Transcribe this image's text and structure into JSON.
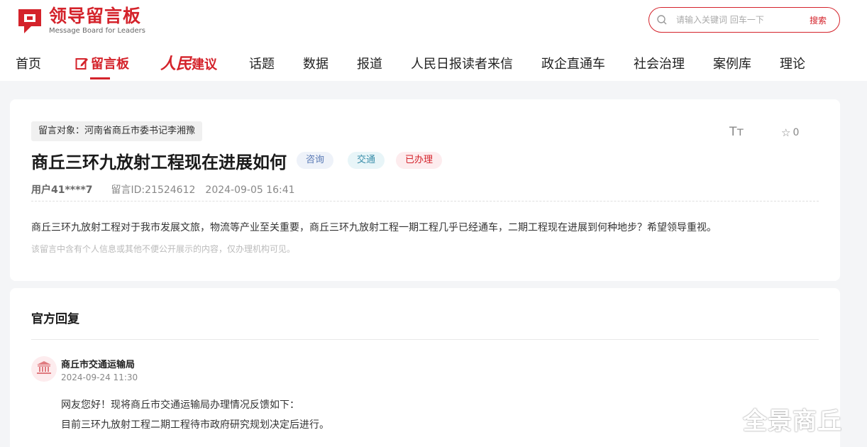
{
  "header": {
    "logo_cn": "领导留言板",
    "logo_en": "Message Board for Leaders",
    "search_placeholder": "请输入关键词 回车一下",
    "search_button": "搜索"
  },
  "nav": {
    "home": "首页",
    "board": "留言板",
    "renmin": "人民",
    "renmin_tail": "建议",
    "topics": "话题",
    "data": "数据",
    "reports": "报道",
    "reader_letters": "人民日报读者来信",
    "gov_enterprise": "政企直通车",
    "governance": "社会治理",
    "cases": "案例库",
    "theory": "理论"
  },
  "message": {
    "target": "留言对象：河南省商丘市委书记李湘豫",
    "font_btn": "Tт",
    "fav_star": "☆",
    "fav_count": "0",
    "title": "商丘三环九放射工程现在进展如何",
    "badges": [
      "咨询",
      "交通",
      "已办理"
    ],
    "user": "用户41****7",
    "msg_id": "留言ID:21524612",
    "datetime": "2024-09-05 16:41",
    "content": "商丘三环九放射工程对于我市发展文旅，物流等产业至关重要，商丘三环九放射工程一期工程几乎已经通车，二期工程现在进展到何种地步？希望领导重视。",
    "notice": "该留言中含有个人信息或其他不便公开展示的内容，仅办理机构可见。"
  },
  "reply": {
    "section_title": "官方回复",
    "org": "商丘市交通运输局",
    "time": "2024-09-24 11:30",
    "line1": "网友您好！现将商丘市交通运输局办理情况反馈如下：",
    "line2": "目前三环九放射工程二期工程待市政府研究规划决定后进行。"
  },
  "watermark": "全景商丘",
  "colors": {
    "brand": "#d4232b"
  }
}
